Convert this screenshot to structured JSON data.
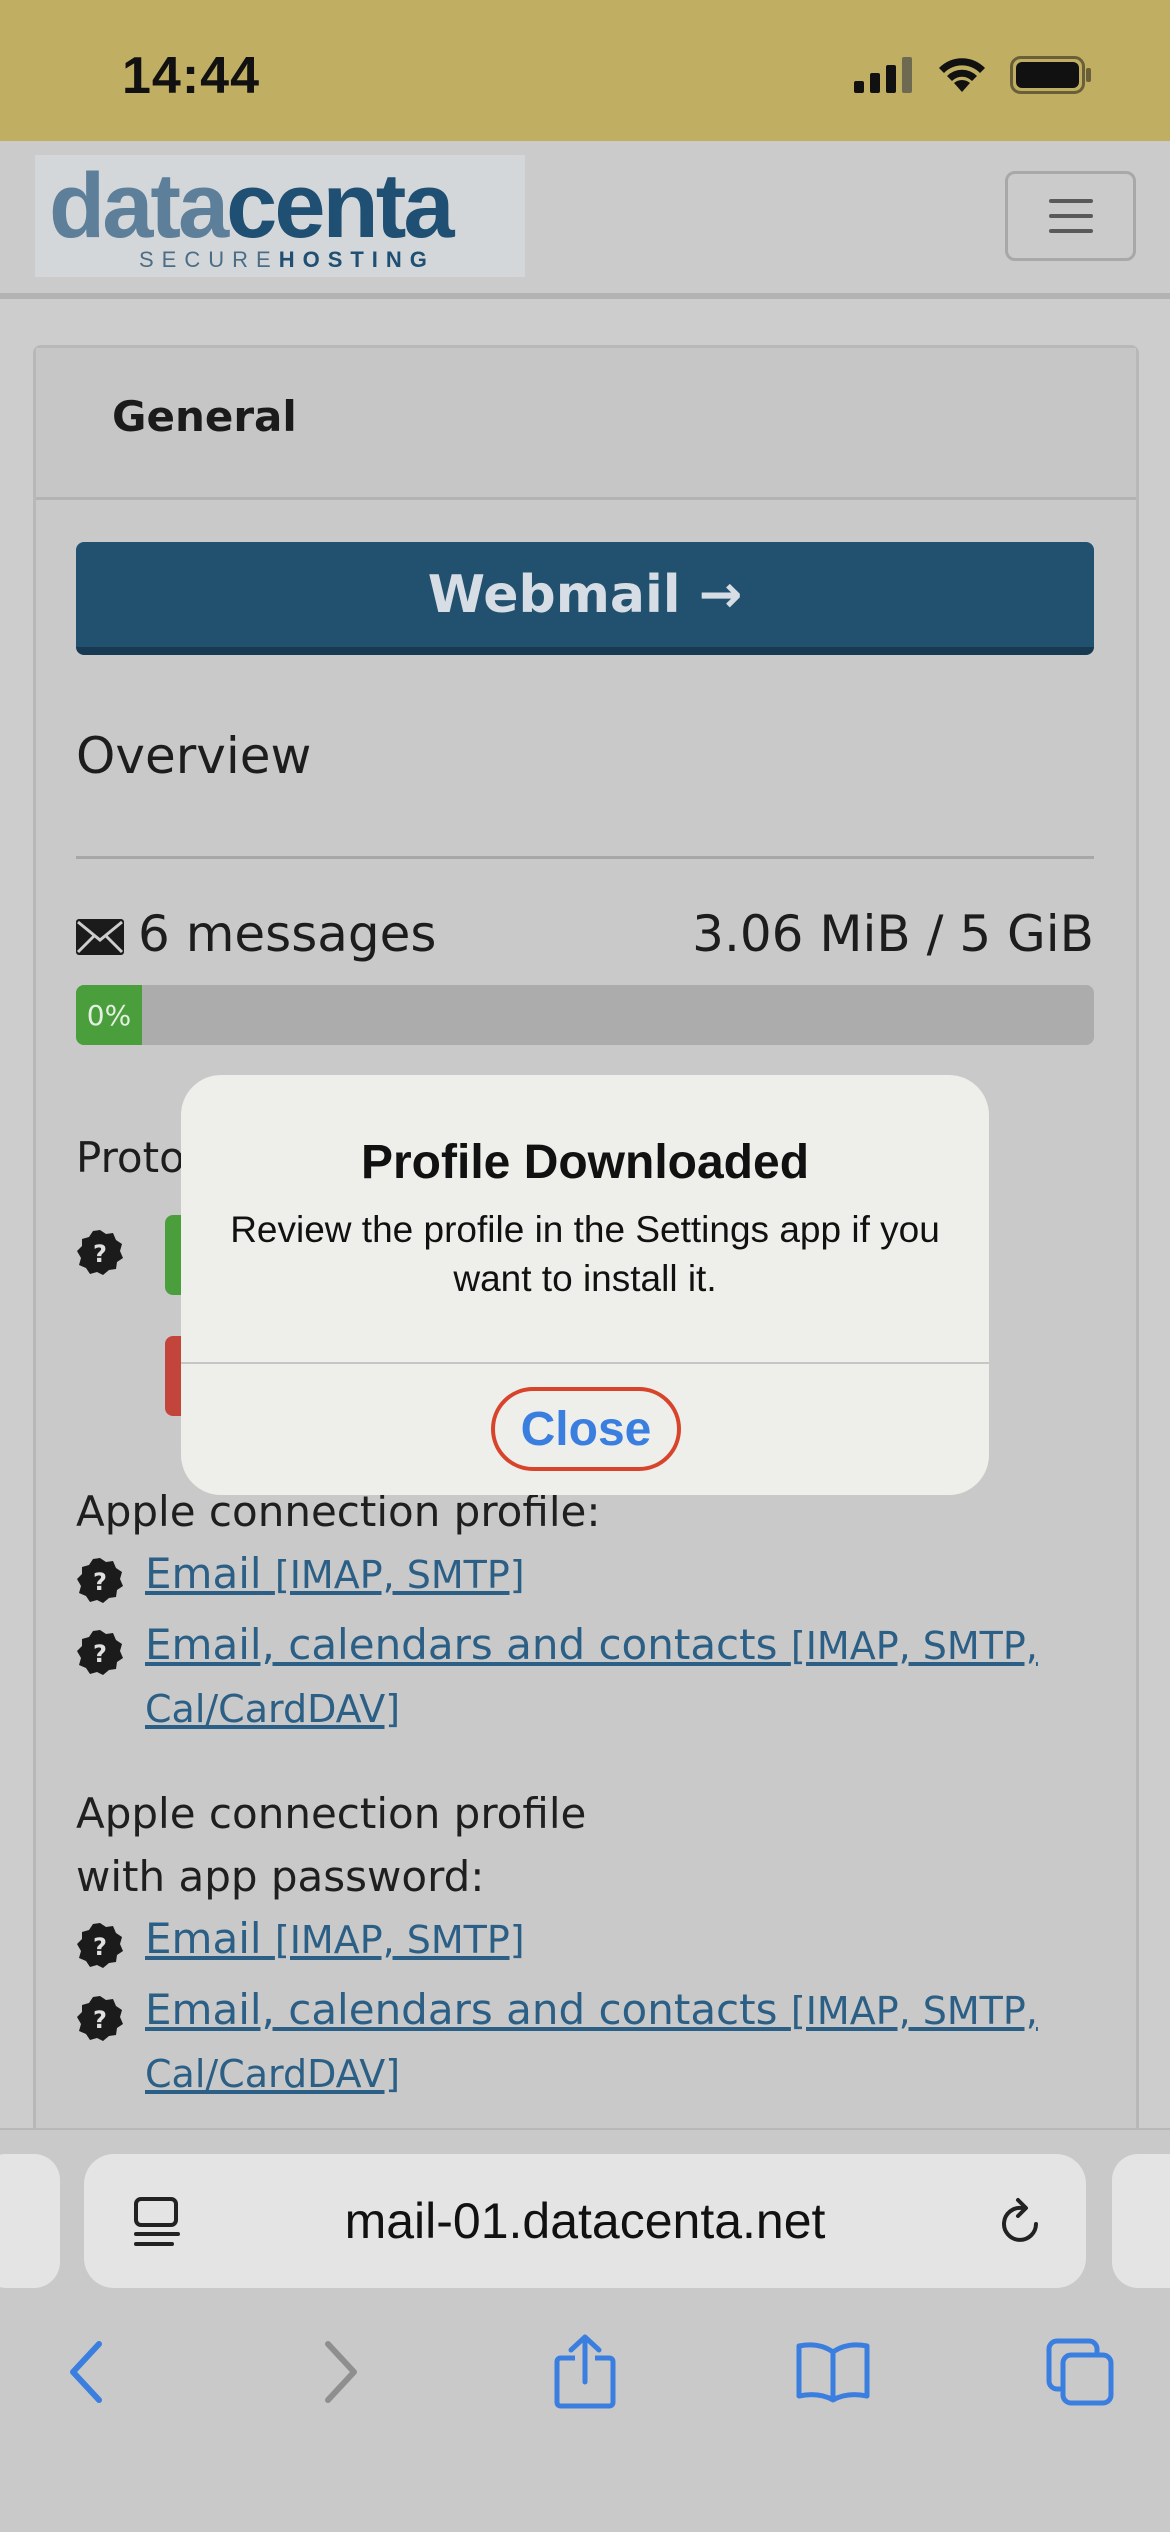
{
  "status_bar": {
    "time": "14:44"
  },
  "site_header": {
    "logo_word_data": "data",
    "logo_word_centa": "centa",
    "logo_tag_secure": "SECURE",
    "logo_tag_hosting": "HOSTING"
  },
  "card": {
    "header_title": "General",
    "webmail_label": "Webmail →",
    "overview_label": "Overview",
    "message_count": "6 messages",
    "quota": "3.06 MiB / 5 GiB",
    "usage_percent_label": "0%",
    "protocols_label_partial": "Proto",
    "apple_profile": {
      "label": "Apple connection profile:",
      "links": [
        {
          "text": "Email",
          "proto": "[IMAP, SMTP]"
        },
        {
          "text": "Email, calendars and contacts",
          "proto": "[IMAP, SMTP,",
          "proto2": "Cal/CardDAV]"
        }
      ]
    },
    "apple_profile_app_pw": {
      "label_line1": "Apple connection profile",
      "label_line2": "with app password:",
      "links": [
        {
          "text": "Email",
          "proto": "[IMAP, SMTP]"
        },
        {
          "text": "Email, calendars and contacts",
          "proto": "[IMAP, SMTP,",
          "proto2": "Cal/CardDAV]"
        }
      ]
    }
  },
  "alert": {
    "title": "Profile Downloaded",
    "message": "Review the profile in the Settings app if you want to install it.",
    "close_label": "Close"
  },
  "browser": {
    "url": "mail-01.datacenta.net",
    "accent_color": "#3a7fe0"
  }
}
